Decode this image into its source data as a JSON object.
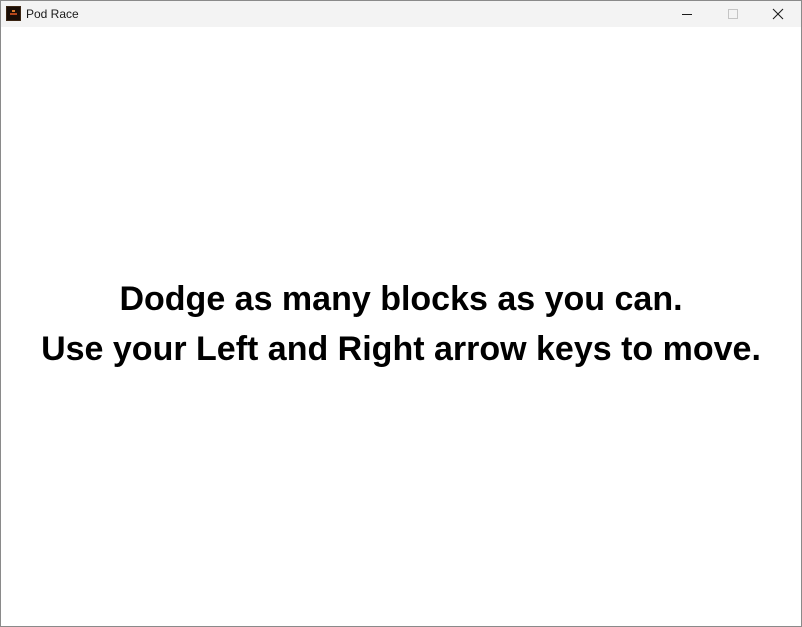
{
  "window": {
    "title": "Pod Race",
    "icon": "pod-race-app-icon",
    "controls": {
      "minimize_icon": "minimize-icon",
      "maximize_icon": "maximize-icon",
      "close_icon": "close-icon"
    }
  },
  "game": {
    "instructions": {
      "line1": "Dodge as many blocks as you can.",
      "line2": "Use your Left and Right arrow keys to move."
    },
    "background_color": "#ffffff",
    "text_color": "#000000"
  }
}
